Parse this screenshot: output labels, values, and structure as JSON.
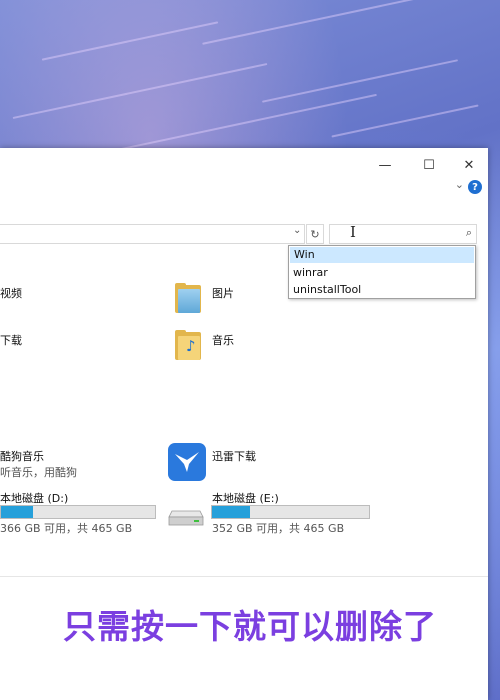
{
  "window": {
    "minimize": "—",
    "maximize": "☐",
    "close": "✕",
    "help": "?",
    "ribbon_toggle": "⌄"
  },
  "address": {
    "dropdown": "⌄",
    "refresh": "↻"
  },
  "search": {
    "value": "",
    "cursor": "I",
    "icon": "⌕"
  },
  "autocomplete": [
    "Win",
    "winrar",
    "uninstallTool"
  ],
  "folders": [
    {
      "label": "视频"
    },
    {
      "label": "图片"
    },
    {
      "label": "下载"
    },
    {
      "label": "音乐"
    }
  ],
  "apps": [
    {
      "label": "酷狗音乐",
      "sub": "听音乐，用酷狗"
    },
    {
      "label": "迅雷下载"
    }
  ],
  "drives": [
    {
      "label": "本地磁盘 (D:)",
      "space": "366 GB 可用，共 465 GB",
      "used_fraction": 0.21
    },
    {
      "label": "本地磁盘 (E:)",
      "space": "352 GB 可用，共 465 GB",
      "used_fraction": 0.24
    }
  ],
  "subtitle": "只需按一下就可以删除了",
  "colors": {
    "accent": "#26a0da",
    "subtitle": "#7b3fe0",
    "selection": "#cce8ff"
  }
}
